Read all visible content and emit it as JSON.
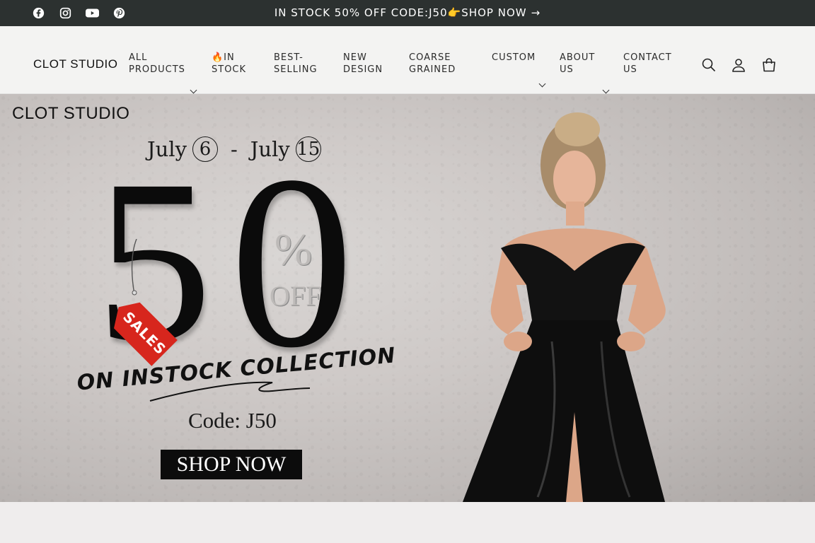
{
  "announcement": {
    "text": "IN STOCK 50% OFF CODE:J50👉SHOP NOW",
    "arrow": "→",
    "social_icons": [
      "facebook-icon",
      "instagram-icon",
      "youtube-icon",
      "pinterest-icon"
    ]
  },
  "header": {
    "logo": "CLOT STUDIO",
    "nav": [
      {
        "label": "ALL\nPRODUCTS",
        "dropdown": true
      },
      {
        "label": "🔥IN\nSTOCK",
        "dropdown": false
      },
      {
        "label": "BEST-\nSELLING",
        "dropdown": false
      },
      {
        "label": "NEW\nDESIGN",
        "dropdown": false
      },
      {
        "label": "COARSE\nGRAINED",
        "dropdown": false
      },
      {
        "label": "CUSTOM",
        "dropdown": true
      },
      {
        "label": "ABOUT\nUS",
        "dropdown": true
      },
      {
        "label": "CONTACT\nUS",
        "dropdown": false
      }
    ],
    "icons": [
      "search-icon",
      "account-icon",
      "cart-icon"
    ]
  },
  "hero": {
    "logo": "CLOT STUDIO",
    "date_start_month": "July",
    "date_start_day": "6",
    "date_separator": "-",
    "date_end_month": "July",
    "date_end_day": "15",
    "big_digit_1": "5",
    "big_digit_2": "0",
    "percent": "%",
    "off": "OFF",
    "tag": "SALES",
    "collection": "ON INSTOCK COLLECTION",
    "code": "Code: J50",
    "button": "SHOP NOW"
  },
  "colors": {
    "announcement_bg": "#2c3130",
    "header_bg": "#f3f3f2",
    "tag_red": "#d7261d",
    "button_bg": "#0c0c0c"
  }
}
